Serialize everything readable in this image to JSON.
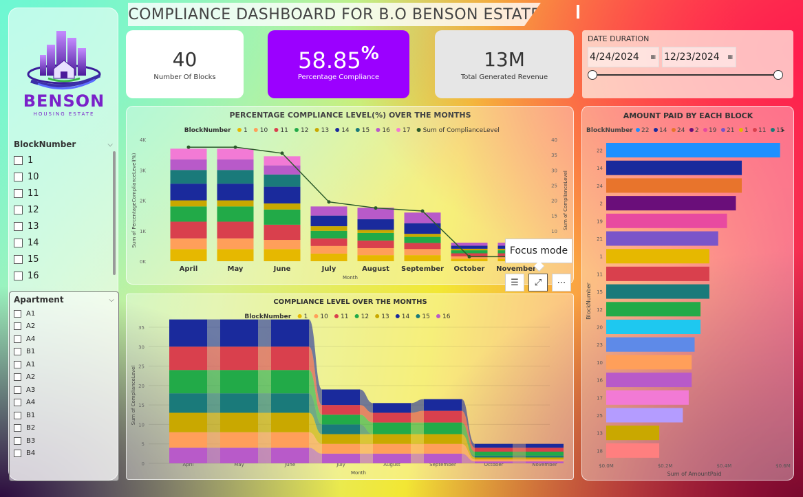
{
  "title": "COMPLIANCE DASHBOARD FOR B.O BENSON ESTATE",
  "logo": {
    "name": "BENSON",
    "sub": "HOUSING ESTATE"
  },
  "kpis": [
    {
      "value": "40",
      "label": "Number Of Blocks"
    },
    {
      "value": "58.85",
      "suffix": "%",
      "label": "Percentage Compliance"
    },
    {
      "value": "13M",
      "label": "Total Generated Revenue"
    }
  ],
  "date": {
    "label": "DATE DURATION",
    "start": "4/24/2024",
    "end": "12/23/2024"
  },
  "block_slicer": {
    "title": "BlockNumber",
    "items": [
      "1",
      "10",
      "11",
      "12",
      "13",
      "14",
      "15",
      "16"
    ]
  },
  "apartment_slicer": {
    "title": "Apartment",
    "items": [
      "A1",
      "A2",
      "A4",
      "B1",
      "A1",
      "A2",
      "A3",
      "A4",
      "B1",
      "B2",
      "B3",
      "B4"
    ]
  },
  "tooltip": "Focus mode",
  "colors": {
    "1": "#e6b800",
    "10": "#ff9f5a",
    "11": "#d9404d",
    "12": "#22aa48",
    "13": "#c9a800",
    "14": "#1a2a9c",
    "15": "#1a7a7a",
    "16": "#b85ac9",
    "17": "#f27ad5",
    "22": "#1e90ff",
    "24": "#e8742c",
    "2": "#6a0e7a",
    "19": "#e84aa0",
    "21": "#7a55c9",
    "23": "#5e8ae8",
    "20": "#1ec8f0",
    "25": "#b49cff",
    "18": "#ff7f7f",
    "purple": "#9b00ff",
    "line": "#2a5a2a"
  },
  "chart_data": [
    {
      "type": "bar",
      "title": "PERCENTAGE COMPLIANCE LEVEL(%) OVER THE MONTHS",
      "legend_title": "BlockNumber",
      "legend": [
        "1",
        "10",
        "11",
        "12",
        "13",
        "14",
        "15",
        "16",
        "17",
        "Sum of ComplianceLevel"
      ],
      "xlabel": "Month",
      "ylabel": "Sum of PercentageComplianceLevel(%)",
      "y2label": "Sum of ComplianceLevel",
      "categories": [
        "April",
        "May",
        "June",
        "July",
        "August",
        "September",
        "October",
        "November"
      ],
      "yticks": [
        "0K",
        "1K",
        "2K",
        "3K",
        "4K"
      ],
      "ylim": [
        0,
        4000
      ],
      "y2ticks": [
        "0",
        "5",
        "10",
        "15",
        "20",
        "25",
        "30",
        "35",
        "40"
      ],
      "y2lim": [
        0,
        40
      ],
      "series": [
        {
          "name": "1",
          "values": [
            400,
            400,
            400,
            250,
            200,
            200,
            80,
            80
          ]
        },
        {
          "name": "10",
          "values": [
            350,
            350,
            300,
            250,
            230,
            200,
            80,
            80
          ]
        },
        {
          "name": "11",
          "values": [
            550,
            550,
            500,
            250,
            250,
            200,
            100,
            100
          ]
        },
        {
          "name": "12",
          "values": [
            500,
            500,
            500,
            250,
            250,
            200,
            100,
            100
          ]
        },
        {
          "name": "13",
          "values": [
            200,
            200,
            200,
            150,
            100,
            100,
            50,
            50
          ]
        },
        {
          "name": "14",
          "values": [
            550,
            550,
            550,
            350,
            350,
            350,
            100,
            100
          ]
        },
        {
          "name": "15",
          "values": [
            450,
            450,
            400,
            0,
            0,
            0,
            0,
            0
          ]
        },
        {
          "name": "16",
          "values": [
            350,
            350,
            300,
            300,
            380,
            350,
            100,
            100
          ]
        },
        {
          "name": "17",
          "values": [
            350,
            350,
            300,
            0,
            0,
            0,
            0,
            0
          ]
        }
      ],
      "line": {
        "name": "Sum of ComplianceLevel",
        "values": [
          37.5,
          37.5,
          35.5,
          19.5,
          17.5,
          16.5,
          1.5,
          1.5
        ]
      }
    },
    {
      "type": "area",
      "title": "COMPLIANCE LEVEL OVER THE MONTHS",
      "legend_title": "BlockNumber",
      "legend": [
        "1",
        "10",
        "11",
        "12",
        "13",
        "14",
        "15",
        "16"
      ],
      "xlabel": "Month",
      "ylabel": "Sum of ComplianceLevel",
      "categories": [
        "April",
        "May",
        "June",
        "July",
        "August",
        "September",
        "October",
        "November"
      ],
      "yticks": [
        "0",
        "5",
        "10",
        "15",
        "20",
        "25",
        "30",
        "35"
      ],
      "ylim": [
        0,
        35
      ],
      "series": [
        {
          "name": "16",
          "values": [
            4,
            4,
            4,
            2.5,
            2.5,
            2.5,
            0.5,
            0.5
          ]
        },
        {
          "name": "10",
          "values": [
            4,
            4,
            4,
            2.5,
            2.5,
            2.5,
            0.5,
            0.5
          ]
        },
        {
          "name": "13",
          "values": [
            5,
            5,
            5,
            2.5,
            2.5,
            2.5,
            0.5,
            0.5
          ]
        },
        {
          "name": "15",
          "values": [
            5,
            5,
            5,
            2.5,
            0,
            0,
            0.5,
            0.5
          ]
        },
        {
          "name": "12",
          "values": [
            6,
            6,
            6,
            2.5,
            3,
            3,
            1,
            1
          ]
        },
        {
          "name": "11",
          "values": [
            6,
            6,
            6,
            2.5,
            2.5,
            3,
            1,
            1
          ]
        },
        {
          "name": "14",
          "values": [
            7,
            7,
            7,
            4,
            2.5,
            3,
            1,
            1
          ]
        }
      ]
    },
    {
      "type": "bar",
      "orientation": "horizontal",
      "title": "AMOUNT PAID BY EACH BLOCK",
      "legend_title": "BlockNumber",
      "legend": [
        "22",
        "14",
        "24",
        "2",
        "19",
        "21",
        "1",
        "11",
        "15"
      ],
      "xlabel": "Sum of AmountPaid",
      "ylabel": "BlockNumber",
      "xticks": [
        "$0.0M",
        "$0.2M",
        "$0.4M",
        "$0.6M"
      ],
      "xlim": [
        0,
        0.6
      ],
      "categories": [
        "22",
        "14",
        "24",
        "2",
        "19",
        "21",
        "1",
        "11",
        "15",
        "12",
        "20",
        "23",
        "10",
        "16",
        "17",
        "25",
        "13",
        "18"
      ],
      "values": [
        0.59,
        0.46,
        0.46,
        0.44,
        0.41,
        0.38,
        0.35,
        0.35,
        0.35,
        0.32,
        0.32,
        0.3,
        0.29,
        0.29,
        0.28,
        0.26,
        0.18,
        0.18
      ]
    }
  ]
}
